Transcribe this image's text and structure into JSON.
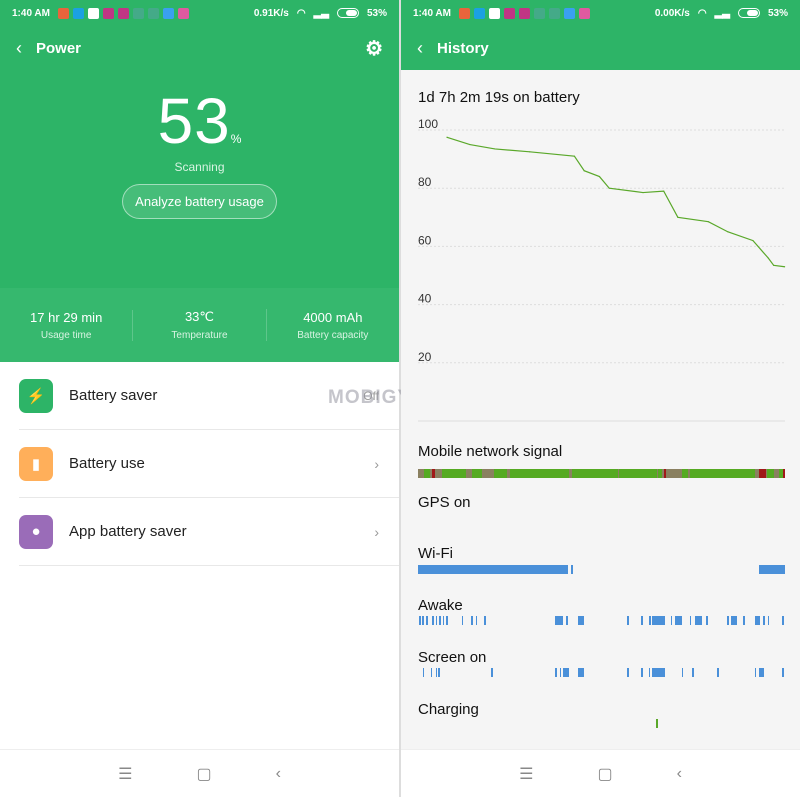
{
  "status_left": {
    "time": "1:40 AM",
    "speed": "0.91K/s",
    "battery": "53%"
  },
  "status_right": {
    "time": "1:40 AM",
    "speed": "0.00K/s",
    "battery": "53%"
  },
  "power": {
    "title": "Power",
    "percent": "53",
    "unit": "%",
    "status": "Scanning",
    "analyze_label": "Analyze battery usage",
    "stats": [
      {
        "value": "17 hr 29 min",
        "label": "Usage time"
      },
      {
        "value": "33℃",
        "label": "Temperature"
      },
      {
        "value": "4000 mAh",
        "label": "Battery capacity"
      }
    ],
    "items": [
      {
        "label": "Battery saver",
        "right": "Off",
        "icon": "battery-bolt-icon",
        "color": "#2db467"
      },
      {
        "label": "Battery use",
        "right": "›",
        "icon": "bar-chart-icon",
        "color": "#ffaf5a"
      },
      {
        "label": "App battery saver",
        "right": "›",
        "icon": "bulb-bolt-icon",
        "color": "#9a6cb8"
      }
    ]
  },
  "history": {
    "title": "History",
    "duration": "1d 7h 2m 19s on battery",
    "sections": {
      "network": "Mobile network signal",
      "gps": "GPS on",
      "wifi": "Wi-Fi",
      "awake": "Awake",
      "screen": "Screen on",
      "charging": "Charging"
    }
  },
  "watermark": "MOBIGYAAN",
  "colors": {
    "accent": "#2db467",
    "line": "#5aa82a",
    "bar_blue": "#4a90d9",
    "signal_good": "#55aa22",
    "signal_poor": "#8a8060",
    "signal_bad": "#a01818"
  },
  "chart_data": {
    "type": "line",
    "ylim": [
      0,
      100
    ],
    "yticks": [
      100,
      80,
      60,
      40,
      20
    ],
    "x_unit": "hours on battery",
    "xlim": [
      0,
      31.04
    ],
    "x": [
      0,
      2.1,
      4.4,
      7.6,
      11.7,
      12.6,
      14,
      14.9,
      18,
      19.9,
      21.2,
      24,
      25.8,
      28.1,
      29.5,
      30,
      31
    ],
    "values": [
      97.5,
      95,
      93.5,
      92.5,
      91,
      86,
      84,
      80,
      78.5,
      79,
      70,
      68.5,
      65,
      62,
      56,
      53.5,
      53
    ]
  },
  "timeline": {
    "network_poor": [
      [
        0,
        0.5
      ],
      [
        1,
        2
      ],
      [
        4.1,
        4.6
      ],
      [
        5.4,
        6.4
      ],
      [
        7.5,
        7.8
      ],
      [
        12.8,
        13
      ],
      [
        16.9,
        17
      ],
      [
        20.2,
        20.3
      ],
      [
        20.6,
        22.3
      ],
      [
        22.8,
        23
      ],
      [
        28.5,
        29.5
      ],
      [
        30.1,
        30.5
      ],
      [
        33.6,
        35.3
      ],
      [
        36,
        37
      ]
    ],
    "network_bad": [
      [
        1.2,
        1.4
      ],
      [
        20.8,
        21
      ],
      [
        28.8,
        29.4
      ],
      [
        30.9,
        31.2
      ]
    ],
    "wifi": [
      [
        0,
        12.7
      ],
      [
        12.95,
        13.1
      ],
      [
        28.8,
        31
      ]
    ],
    "awake": [
      [
        0.1,
        0.2
      ],
      [
        0.35,
        0.5
      ],
      [
        0.7,
        0.8
      ],
      [
        1.2,
        1.3
      ],
      [
        1.5,
        1.6
      ],
      [
        1.8,
        1.9
      ],
      [
        2.1,
        2.2
      ],
      [
        2.4,
        2.5
      ],
      [
        3.7,
        3.8
      ],
      [
        4.5,
        4.6
      ],
      [
        4.9,
        5
      ],
      [
        5.6,
        5.7
      ],
      [
        11.6,
        12.3
      ],
      [
        12.5,
        12.7
      ],
      [
        13.5,
        14.0
      ],
      [
        17.7,
        17.8
      ],
      [
        18.9,
        19
      ],
      [
        19.5,
        19.7
      ],
      [
        19.8,
        20.9
      ],
      [
        21.4,
        21.5
      ],
      [
        21.7,
        22.3
      ],
      [
        23,
        23.1
      ],
      [
        23.4,
        24
      ],
      [
        24.4,
        24.5
      ],
      [
        26.1,
        26.3
      ],
      [
        26.5,
        27
      ],
      [
        27.5,
        27.6
      ],
      [
        28.5,
        28.9
      ],
      [
        29.2,
        29.3
      ],
      [
        29.6,
        29.7
      ],
      [
        30.8,
        30.9
      ]
    ],
    "screen": [
      [
        0.4,
        0.5
      ],
      [
        1.1,
        1.2
      ],
      [
        1.5,
        1.6
      ],
      [
        1.7,
        1.8
      ],
      [
        6.2,
        6.3
      ],
      [
        11.6,
        11.7
      ],
      [
        12.0,
        12.1
      ],
      [
        12.3,
        12.8
      ],
      [
        13.5,
        14.0
      ],
      [
        17.7,
        17.8
      ],
      [
        18.9,
        19
      ],
      [
        19.5,
        19.6
      ],
      [
        19.8,
        20.9
      ],
      [
        22.3,
        22.4
      ],
      [
        23.2,
        23.3
      ],
      [
        25.3,
        25.4
      ],
      [
        28.5,
        28.6
      ],
      [
        28.8,
        29.3
      ],
      [
        30.8,
        30.9
      ]
    ],
    "charging": [
      [
        20.1,
        20.3
      ]
    ]
  }
}
